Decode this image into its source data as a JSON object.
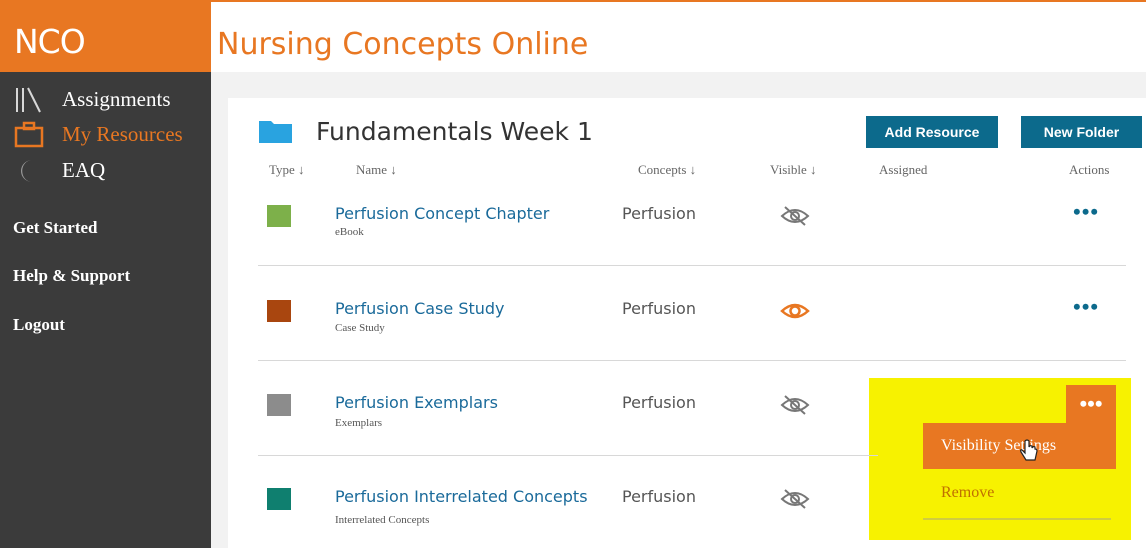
{
  "brand": "NCO",
  "app_title": "Nursing Concepts Online",
  "sidebar": {
    "nav": [
      {
        "label": "Assignments",
        "icon": "books-icon",
        "active": false
      },
      {
        "label": "My Resources",
        "icon": "briefcase-icon",
        "active": true
      },
      {
        "label": "EAQ",
        "icon": "moon-icon",
        "active": false
      }
    ],
    "links": [
      "Get Started",
      "Help & Support",
      "Logout"
    ]
  },
  "folder": {
    "title": "Fundamentals Week 1",
    "add_resource_label": "Add Resource",
    "new_folder_label": "New Folder"
  },
  "columns": {
    "type": "Type ↓",
    "name": "Name ↓",
    "concepts": "Concepts ↓",
    "visible": "Visible ↓",
    "assigned": "Assigned",
    "actions": "Actions"
  },
  "rows": [
    {
      "name": "Perfusion Concept Chapter",
      "type": "eBook",
      "concept": "Perfusion",
      "visible": false,
      "swatch": "#7db04a"
    },
    {
      "name": "Perfusion Case Study",
      "type": "Case Study",
      "concept": "Perfusion",
      "visible": true,
      "swatch": "#a9460f"
    },
    {
      "name": "Perfusion Exemplars",
      "type": "Exemplars",
      "concept": "Perfusion",
      "visible": false,
      "swatch": "#8c8c8c"
    },
    {
      "name": "Perfusion Interrelated Concepts",
      "type": "Interrelated Concepts",
      "concept": "Perfusion",
      "visible": false,
      "swatch": "#0f7f6f"
    }
  ],
  "actions_label": "•••",
  "menu": {
    "visibility_settings": "Visibility Settings",
    "remove": "Remove"
  },
  "colors": {
    "accent": "#e87722",
    "sidebar": "#3b3b3b",
    "button": "#0c6a8c",
    "highlight": "#f7f200"
  }
}
